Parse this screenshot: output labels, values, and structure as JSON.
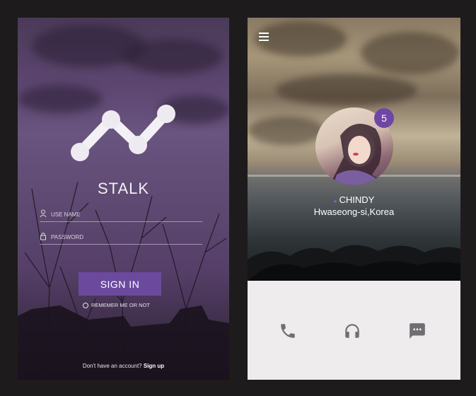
{
  "login": {
    "app_title": "STALK",
    "username_placeholder": "USE NAME",
    "password_placeholder": "PASSWORD",
    "signin_label": "SIGN IN",
    "remember_label": "REMEMER ME OR NOT",
    "signup_prompt": "Don't have an account?",
    "signup_link": "Sign up",
    "accent_color": "#6b4a9e"
  },
  "profile": {
    "menu_icon": "hamburger-menu-icon",
    "badge_count": "5",
    "name": "CHINDY",
    "location": "Hwaseong-si,Korea",
    "actions": [
      {
        "icon": "phone-icon"
      },
      {
        "icon": "headphones-icon"
      },
      {
        "icon": "chat-icon"
      }
    ],
    "accent_color": "#6f46a6"
  }
}
